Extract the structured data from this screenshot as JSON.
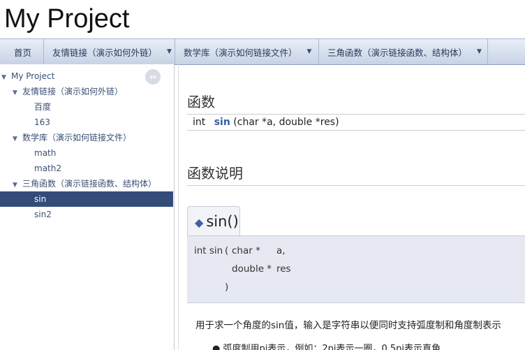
{
  "header": {
    "title": "My Project"
  },
  "nav": {
    "items": [
      {
        "label": "首页"
      },
      {
        "label": "友情链接（演示如何外链）",
        "arrow": "▼"
      },
      {
        "label": "数学库（演示如何链接文件）",
        "arrow": "▼"
      },
      {
        "label": "三角函数（演示链接函数、结构体）",
        "arrow": "▼"
      }
    ]
  },
  "sidebar": {
    "root": "My Project",
    "groups": [
      {
        "label": "友情链接（演示如何外链）",
        "items": [
          "百度",
          "163"
        ]
      },
      {
        "label": "数学库（演示如何链接文件）",
        "items": [
          "math",
          "math2"
        ]
      },
      {
        "label": "三角函数（演示链接函数、结构体）",
        "items": [
          "sin",
          "sin2"
        ]
      }
    ],
    "selected": "sin",
    "toggle_symbol": "↔"
  },
  "main": {
    "functions_heading": "函数",
    "signature": {
      "type": "int",
      "name": "sin",
      "params": "(char *a, double *res)"
    },
    "detail_heading": "函数说明",
    "member": {
      "name": "sin()",
      "ret": "int sin",
      "open": "(",
      "p1_type": "char *",
      "p1_name": "a,",
      "p2_type": "double *",
      "p2_name": "res",
      "close": ")"
    },
    "description": "用于求一个角度的sin值，输入是字符串以便同时支持弧度制和角度制表示",
    "bullet": "弧度制用pi表示，例如：2pi表示一圈，0.5pi表示直角"
  }
}
